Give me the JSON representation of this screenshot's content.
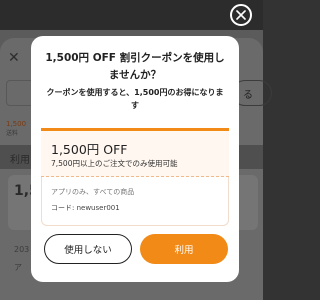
{
  "background": {
    "input_button": "る",
    "orange_note": "1,500",
    "small_note": "送料",
    "tab_label": "利用",
    "number": "1,5",
    "row1": "203",
    "row2": "ア"
  },
  "modal": {
    "title": "1,500円 OFF 割引クーポンを使用しませんか？",
    "subtitle": "クーポンを使用すると、1,500円のお得になります",
    "coupon": {
      "amount": "1,500円 OFF",
      "condition": "7,500円以上のご注文でのみ使用可能",
      "scope": "アプリのみ、すべての商品",
      "code_label": "コード: newuser001"
    },
    "buttons": {
      "decline": "使用しない",
      "accept": "利用"
    }
  },
  "colors": {
    "accent": "#f28a17"
  }
}
